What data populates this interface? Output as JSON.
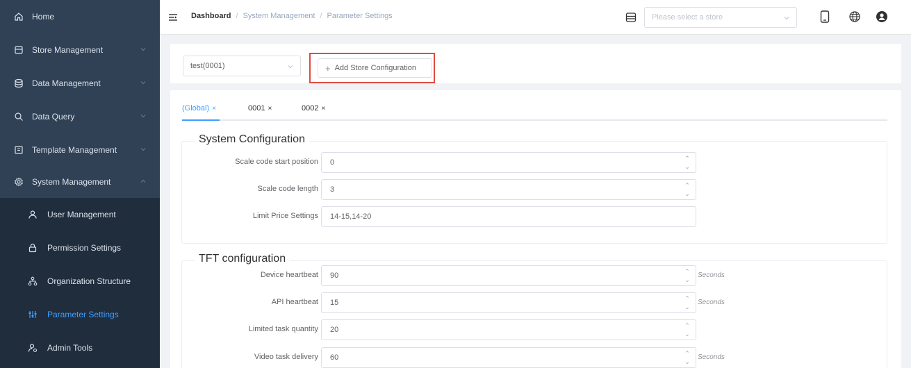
{
  "sidebar": {
    "items": [
      {
        "label": "Home",
        "icon": "home-icon"
      },
      {
        "label": "Store Management",
        "icon": "store-icon"
      },
      {
        "label": "Data Management",
        "icon": "database-icon"
      },
      {
        "label": "Data Query",
        "icon": "search-icon"
      },
      {
        "label": "Template Management",
        "icon": "template-icon"
      },
      {
        "label": "System Management",
        "icon": "gear-icon"
      }
    ],
    "subitems": [
      {
        "label": "User Management",
        "icon": "user-icon"
      },
      {
        "label": "Permission Settings",
        "icon": "lock-icon"
      },
      {
        "label": "Organization Structure",
        "icon": "org-structure-icon"
      },
      {
        "label": "Parameter Settings",
        "icon": "parameter-icon"
      },
      {
        "label": "Admin Tools",
        "icon": "admin-tools-icon"
      }
    ]
  },
  "header": {
    "breadcrumb": [
      "Dashboard",
      "System Management",
      "Parameter Settings"
    ],
    "store_placeholder": "Please select a store"
  },
  "toolbar": {
    "store_value": "test(0001)",
    "add_label": "Add Store Configuration"
  },
  "tabs": [
    "(Global)",
    "0001",
    "0002"
  ],
  "system_config": {
    "title": "System Configuration",
    "fields": [
      {
        "label": "Scale code start position",
        "value": "0"
      },
      {
        "label": "Scale code length",
        "value": "3"
      },
      {
        "label": "Limit Price Settings",
        "value": "14-15,14-20"
      }
    ]
  },
  "tft_config": {
    "title": "TFT configuration",
    "fields": [
      {
        "label": "Device heartbeat",
        "value": "90",
        "unit": "Seconds"
      },
      {
        "label": "API heartbeat",
        "value": "15",
        "unit": "Seconds"
      },
      {
        "label": "Limited task quantity",
        "value": "20"
      },
      {
        "label": "Video task delivery",
        "value": "60",
        "unit": "Seconds"
      }
    ]
  },
  "colors": {
    "sidebar_bg": "#304156",
    "submenu_bg": "#1f2d3d",
    "accent": "#409eff",
    "highlight_border": "#e04b3f"
  }
}
